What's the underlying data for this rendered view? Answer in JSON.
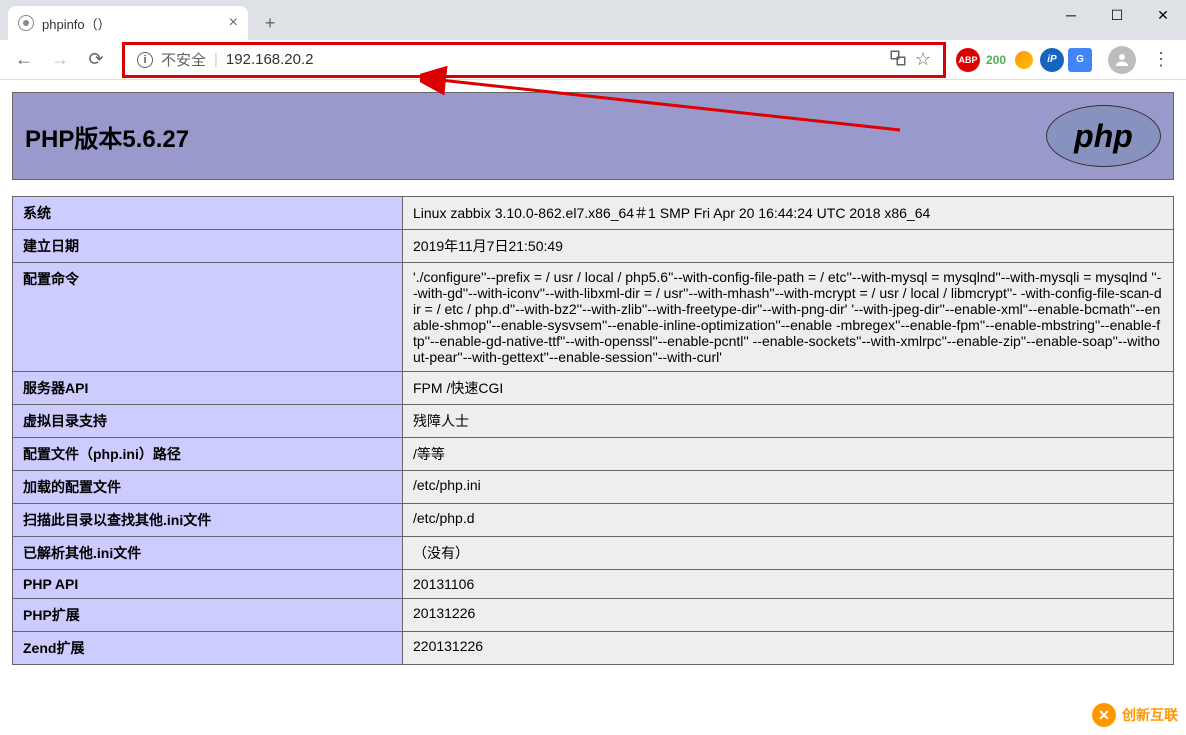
{
  "tab": {
    "title": "phpinfo（）"
  },
  "url": {
    "not_secure": "不安全",
    "address": "192.168.20.2"
  },
  "ext": {
    "abp": "ABP",
    "count": "200",
    "ip": "iP",
    "gt": "G"
  },
  "php": {
    "version_label": "PHP版本5.6.27",
    "logo_text": "php"
  },
  "rows": [
    {
      "k": "系统",
      "v": "Linux zabbix 3.10.0-862.el7.x86_64＃1 SMP Fri Apr 20 16:44:24 UTC 2018 x86_64"
    },
    {
      "k": "建立日期",
      "v": "2019年11月7日21:50:49"
    },
    {
      "k": "配置命令",
      "v": "'./configure''--prefix = / usr / local / php5.6''--with-config-file-path = / etc''--with-mysql = mysqlnd''--with-mysqli = mysqlnd ''--with-gd''--with-iconv''--with-libxml-dir = / usr''--with-mhash''--with-mcrypt = / usr / local / libmcrypt''- -with-config-file-scan-dir = / etc / php.d''--with-bz2''--with-zlib''--with-freetype-dir''--with-png-dir' '--with-jpeg-dir''--enable-xml''--enable-bcmath''--enable-shmop''--enable-sysvsem''--enable-inline-optimization''--enable -mbregex''--enable-fpm''--enable-mbstring''--enable-ftp''--enable-gd-native-ttf''--with-openssl''--enable-pcntl'' --enable-sockets''--with-xmlrpc''--enable-zip''--enable-soap''--without-pear''--with-gettext''--enable-session''--with-curl'"
    },
    {
      "k": "服务器API",
      "v": "FPM /快速CGI"
    },
    {
      "k": "虚拟目录支持",
      "v": "残障人士"
    },
    {
      "k": "配置文件（php.ini）路径",
      "v": "/等等"
    },
    {
      "k": "加载的配置文件",
      "v": "/etc/php.ini"
    },
    {
      "k": "扫描此目录以查找其他.ini文件",
      "v": "/etc/php.d"
    },
    {
      "k": "已解析其他.ini文件",
      "v": "（没有）"
    },
    {
      "k": "PHP API",
      "v": "20131106"
    },
    {
      "k": "PHP扩展",
      "v": "20131226"
    },
    {
      "k": "Zend扩展",
      "v": "220131226"
    }
  ],
  "watermark": {
    "text": "创新互联"
  }
}
